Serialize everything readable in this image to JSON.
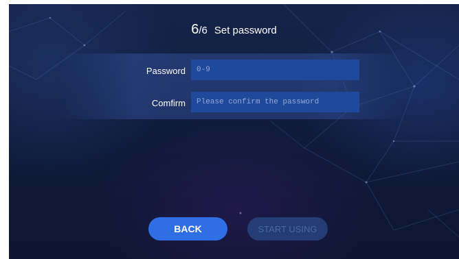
{
  "header": {
    "step_current": "6",
    "step_total": "/6",
    "title": "Set password"
  },
  "form": {
    "password": {
      "label": "Password",
      "value": "",
      "placeholder": "0-9"
    },
    "confirm": {
      "label": "Comfirm",
      "value": "",
      "placeholder": "Please confirm the password"
    }
  },
  "buttons": {
    "back": "BACK",
    "start": "START USING",
    "start_disabled": true
  },
  "colors": {
    "background": "#12204a",
    "input_fill": "#1f4a9c",
    "primary_button": "#2f6ee4",
    "disabled_button": "#243d74"
  }
}
